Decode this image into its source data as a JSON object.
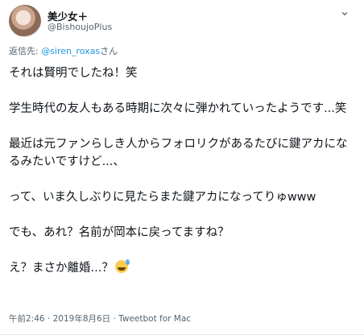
{
  "author": {
    "display_name": "美少女＋",
    "handle": "@BishoujoPlus"
  },
  "reply": {
    "prefix": "返信先: ",
    "mention": "@siren_roxas",
    "suffix": "さん"
  },
  "tweet": {
    "line1": "それは賢明でしたね！笑",
    "line2": "学生時代の友人もある時期に次々に弾かれていったようです...笑",
    "line3": "最近は元ファンらしき人からフォロリクがあるたびに鍵アカになるみたいですけど...、",
    "line4": "って、いま久しぶりに見たらまた鍵アカになってりゅwww",
    "line5": "でも、あれ？名前が岡本に戻ってますね？",
    "line6": "え？まさか離婚...？"
  },
  "meta": {
    "text": "午前2:46 · 2019年8月6日 · Tweetbot for Mac"
  },
  "icons": {
    "more": "chevron-down-icon",
    "emoji": "sweat-smile-emoji-icon"
  },
  "colors": {
    "text": "#0f1419",
    "secondary": "#536471",
    "mention": "#1b95e0"
  }
}
